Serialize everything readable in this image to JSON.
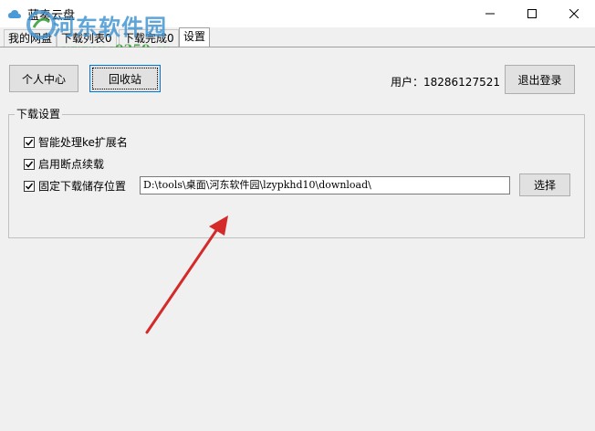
{
  "window": {
    "title": "蓝奏云盘",
    "watermark_text": "河东软件园",
    "watermark_url": "www.pc0359.cn"
  },
  "tabs": [
    {
      "label": "我的网盘"
    },
    {
      "label": "下载列表0"
    },
    {
      "label": "下载完成0"
    },
    {
      "label": "设置"
    }
  ],
  "toolbar": {
    "profile_label": "个人中心",
    "recycle_label": "回收站",
    "user_label": "用户：18286127521",
    "logout_label": "退出登录"
  },
  "download_settings": {
    "group_title": "下载设置",
    "options": [
      {
        "label": "智能处理ke扩展名",
        "checked": true
      },
      {
        "label": "启用断点续载",
        "checked": true
      },
      {
        "label": "固定下载储存位置",
        "checked": true
      }
    ],
    "path_value": "D:\\tools\\桌面\\河东软件园\\lzypkhd10\\download\\",
    "choose_label": "选择"
  },
  "colors": {
    "annotation_arrow": "#d42a2a",
    "watermark": "#4295d2",
    "focus_border": "#0078d7"
  }
}
